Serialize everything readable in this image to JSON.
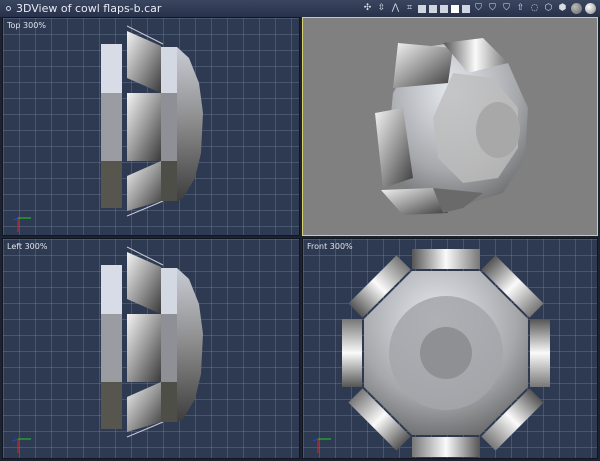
{
  "window": {
    "title": "3DView of cowl flaps-b.car"
  },
  "toolbar": {
    "icons": [
      "move-icon",
      "scale-icon",
      "align-icon",
      "grid-icon",
      "layout-1-icon",
      "layout-2-icon",
      "layout-3-icon",
      "layout-4-icon",
      "layout-5-icon",
      "shield-1-icon",
      "shield-2-icon",
      "shield-3-icon",
      "up-arrow-icon",
      "dotted-circle-icon",
      "cube-wire-icon",
      "cube-solid-icon",
      "sphere-gray-icon",
      "sphere-shaded-icon"
    ]
  },
  "viewports": {
    "top": {
      "label": "Top 300%"
    },
    "perspective": {
      "label": ""
    },
    "left": {
      "label": "Left 300%"
    },
    "front": {
      "label": "Front 300%"
    }
  },
  "axes": {
    "x": "x",
    "y": "y",
    "z": "z"
  },
  "colors": {
    "viewport_bg": "#2e3a52",
    "perspective_bg": "#808080",
    "active_border": "#d8d070"
  }
}
